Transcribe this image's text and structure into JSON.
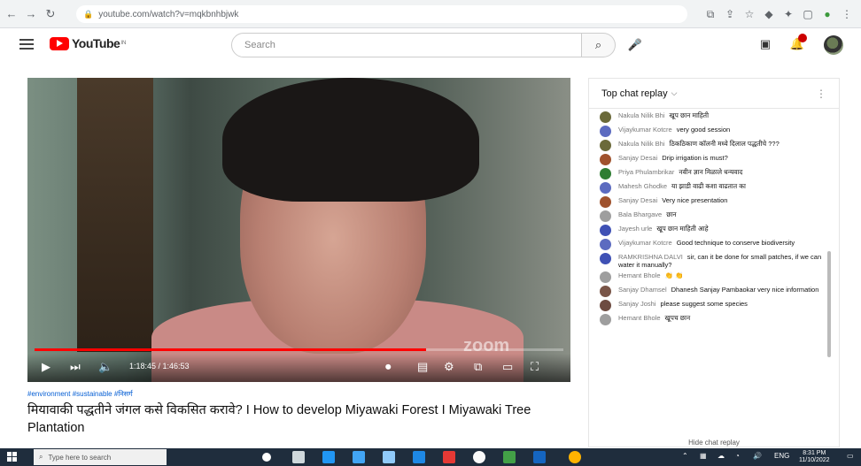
{
  "browser": {
    "url": "youtube.com/watch?v=mqkbnhbjwk",
    "icons": [
      "back-icon",
      "forward-icon",
      "reload-icon",
      "lock-icon"
    ],
    "extension_icons": [
      "translate-icon",
      "share-icon",
      "star-icon",
      "extension-icon",
      "puzzle-icon",
      "window-icon",
      "profile-icon",
      "menu-icon"
    ]
  },
  "youtube": {
    "logo_text": "YouTube",
    "logo_sup": "IN",
    "search_placeholder": "Search"
  },
  "video": {
    "current_time": "1:18:45 / 1:46:53",
    "progress": 0.74,
    "watermark": "zoom",
    "tags": "#environment #sustainable #निसर्ग",
    "title": "मियावाकी पद्धतीने जंगल कसे विकसित करावे? I How to develop Miyawaki Forest I Miyawaki Tree Plantation"
  },
  "chat": {
    "header": "Top chat replay",
    "footer": "Hide chat replay",
    "messages": [
      {
        "author": "Nakula Nilik Bhi",
        "text": "खूप छान माहिती",
        "color": "#6b6a3a"
      },
      {
        "author": "Vijaykumar Kotcre",
        "text": "very good session",
        "color": "#5c6bc0"
      },
      {
        "author": "Nakula Nilik Bhi",
        "text": "ठिकठिकाण कॉलनी मध्ये दिलाल पद्धतीचे ???",
        "color": "#6b6a3a"
      },
      {
        "author": "Sanjay Desai",
        "text": "Drip irrigation is must?",
        "color": "#a0522d"
      },
      {
        "author": "Priya Phulambrikar",
        "text": "नवीन ज्ञान मिळाले धन्यवाद",
        "color": "#2e7d32"
      },
      {
        "author": "Mahesh Ghodke",
        "text": "या झाडी वाढी कशा वाढतात का",
        "color": "#5c6bc0"
      },
      {
        "author": "Sanjay Desai",
        "text": "Very nice presentation",
        "color": "#a0522d"
      },
      {
        "author": "Bala Bhargave",
        "text": "छान",
        "color": "#9e9e9e"
      },
      {
        "author": "Jayesh urle",
        "text": "खूप छान माहिती आहे",
        "color": "#3f51b5"
      },
      {
        "author": "Vijaykumar Kotcre",
        "text": "Good technique to conserve biodiversity",
        "color": "#5c6bc0"
      },
      {
        "author": "RAMKRISHNA DALVI",
        "text": "sir, can it be done for small patches, if we can water it manually?",
        "color": "#3f51b5"
      },
      {
        "author": "Hemant Bhole",
        "text": "👏 👏",
        "color": "#9e9e9e"
      },
      {
        "author": "Sanjay Dhamsel",
        "text": "Dhanesh Sanjay Pambaokar very nice information",
        "color": "#795548"
      },
      {
        "author": "Sanjay Joshi",
        "text": "please suggest some species",
        "color": "#6d4c41"
      },
      {
        "author": "Hemant Bhole",
        "text": "खूपच छान",
        "color": "#9e9e9e"
      }
    ]
  },
  "taskbar": {
    "search_placeholder": "Type here to search",
    "time": "8:31 PM",
    "date": "11/10/2022",
    "lang": "ENG"
  }
}
